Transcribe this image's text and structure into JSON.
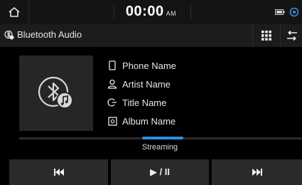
{
  "status_bar": {
    "time": "00:00",
    "ampm": "AM",
    "icons": [
      "home-icon",
      "battery-icon",
      "connectivity-icon"
    ]
  },
  "title_bar": {
    "title": "Bluetooth Audio",
    "icons": [
      "bluetooth-audio-icon",
      "grid-menu-icon",
      "back-icon"
    ]
  },
  "track_info": {
    "items": [
      {
        "icon": "phone-icon",
        "label": "Phone Name"
      },
      {
        "icon": "artist-icon",
        "label": "Artist Name"
      },
      {
        "icon": "title-icon",
        "label": "Title Name"
      },
      {
        "icon": "album-icon",
        "label": "Album Name"
      }
    ]
  },
  "status": {
    "label": "Streaming"
  },
  "controls": {
    "play_pause_label": "▶ / II",
    "icons": [
      "skip-previous-icon",
      "skip-next-icon"
    ]
  },
  "colors": {
    "accent": "#2f8de4",
    "background": "#000000",
    "panel": "#1c1c1c",
    "button": "#2a2a2a"
  }
}
